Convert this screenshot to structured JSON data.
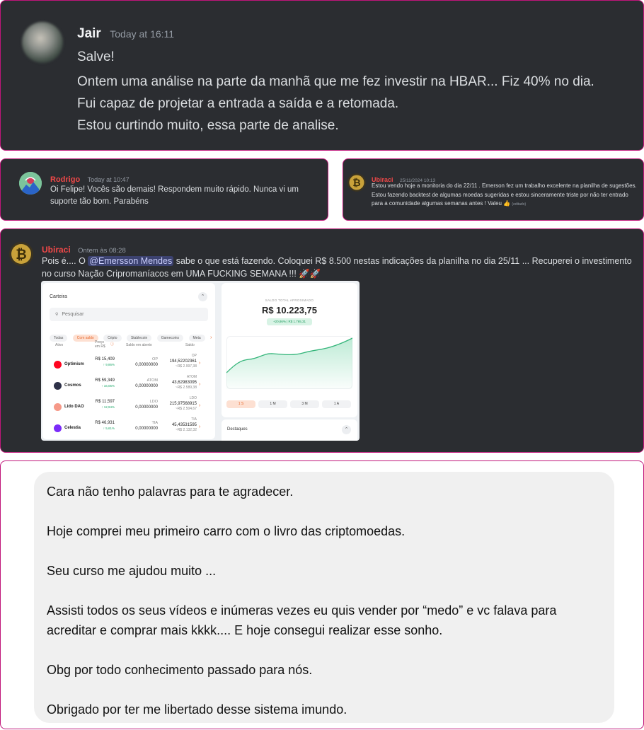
{
  "msg1": {
    "author": "Jair",
    "time": "Today at 16:11",
    "lines": [
      "Salve!",
      "Ontem uma análise na parte da manhã que me fez investir na HBAR... Fiz 40% no dia.",
      "Fui capaz de projetar a entrada a saída e a retomada.",
      "Estou curtindo muito, essa parte de analise."
    ]
  },
  "msg2": {
    "author": "Rodrigo",
    "time": "Today at 10:47",
    "text": "Oi Felipe! Vocês são demais! Respondem muito rápido. Nunca vi um suporte tão bom. Parabéns"
  },
  "msg3": {
    "author": "Ubiraci",
    "time": "25/11/2024 10:13",
    "text": "Estou vendo hoje a monitoria do dia 22/11 .  Emerson fez um trabalho excelente na planilha de sugestões. Estou fazendo backtest de algumas moedas sugeridas e estou sinceramente triste por não ter entrado para a comunidade algumas semanas antes !  Valeu",
    "emoji": "👍",
    "edited": "(editado)"
  },
  "msg4": {
    "author": "Ubiraci",
    "time": "Ontem às 08:28",
    "text_before": "Pois é.... O ",
    "mention": "@Emersson Mendes",
    "text_after": "  sabe o que está fazendo.  Coloquei R$ 8.500 nestas indicações da planilha no dia 25/11 ...  Recuperei o investimento no curso Nação Cripromaníacos em UMA FUCKING SEMANA !!! ",
    "emoji": "🚀🚀",
    "wallet": {
      "title": "Carteira",
      "search_placeholder": "Pesquisar",
      "filters": [
        "Todas",
        "Com saldo",
        "Cripto",
        "Stablecoin",
        "Gamecoins",
        "Meta"
      ],
      "active_filter": "Com saldo",
      "col_asset": "Ativo",
      "col_price_1": "Preço",
      "col_price_2": "em R$",
      "col_open": "Saldo em aberto",
      "col_balance": "Saldo",
      "rows": [
        {
          "name": "Optimism",
          "price": "R$ 15,409",
          "pct": "↑ 9,86%",
          "open_ticker": "OP",
          "open_value": "0,00000000",
          "bal_ticker": "OP",
          "bal_value": "194,52202361",
          "bal_brl": "~R$ 2.997,38",
          "color": "#ff0420"
        },
        {
          "name": "Cosmos",
          "price": "R$ 59,349",
          "pct": "↑ 16,05%",
          "open_ticker": "ATOM",
          "open_value": "0,00000000",
          "bal_ticker": "ATOM",
          "bal_value": "43,62983095",
          "bal_brl": "~R$ 2.589,38",
          "color": "#2e3148"
        },
        {
          "name": "Lido DAO",
          "price": "R$ 11,597",
          "pct": "↑ 12,94%",
          "open_ticker": "LDO",
          "open_value": "0,00000000",
          "bal_ticker": "LDO",
          "bal_value": "215,97568915",
          "bal_brl": "~R$ 2.504,67",
          "color": "#f69988"
        },
        {
          "name": "Celestia",
          "price": "R$ 46,931",
          "pct": "↑ 5,61%",
          "open_ticker": "TIA",
          "open_value": "0,00000000",
          "bal_ticker": "TIA",
          "bal_value": "45,43531595",
          "bal_brl": "~R$ 2.132,32",
          "color": "#7b2bf9"
        }
      ]
    },
    "balance": {
      "label": "SALDO TOTAL APROXIMADO",
      "value": "R$ 10.223,75",
      "change": "+20,86% | R$ 1.765,31",
      "periods": [
        "1 S",
        "1 M",
        "3 M",
        "1 A"
      ],
      "active_period": "1 S",
      "highlights_title": "Destaques"
    }
  },
  "msg5": {
    "paragraphs": [
      "Cara não tenho palavras para te agradecer.",
      "Hoje comprei meu primeiro carro com o livro das criptomoedas.",
      "Seu curso me ajudou muito ...",
      "Assisti todos os seus vídeos e inúmeras vezes eu quis vender por “medo” e vc falava para acreditar e comprar mais kkkk.... E hoje consegui realizar esse sonho.",
      "Obg por todo conhecimento passado para nós.",
      "Obrigado por ter me libertado desse sistema imundo."
    ]
  },
  "icons": {
    "chevron": "⌃",
    "search": "🔍",
    "arrow": "›",
    "bitcoin": "₿"
  },
  "colors": {
    "card_bg": "#2b2d31",
    "border": "#c0157a",
    "name_red": "#f04848",
    "accent_orange": "#e8692e",
    "green": "#1fa86a"
  }
}
